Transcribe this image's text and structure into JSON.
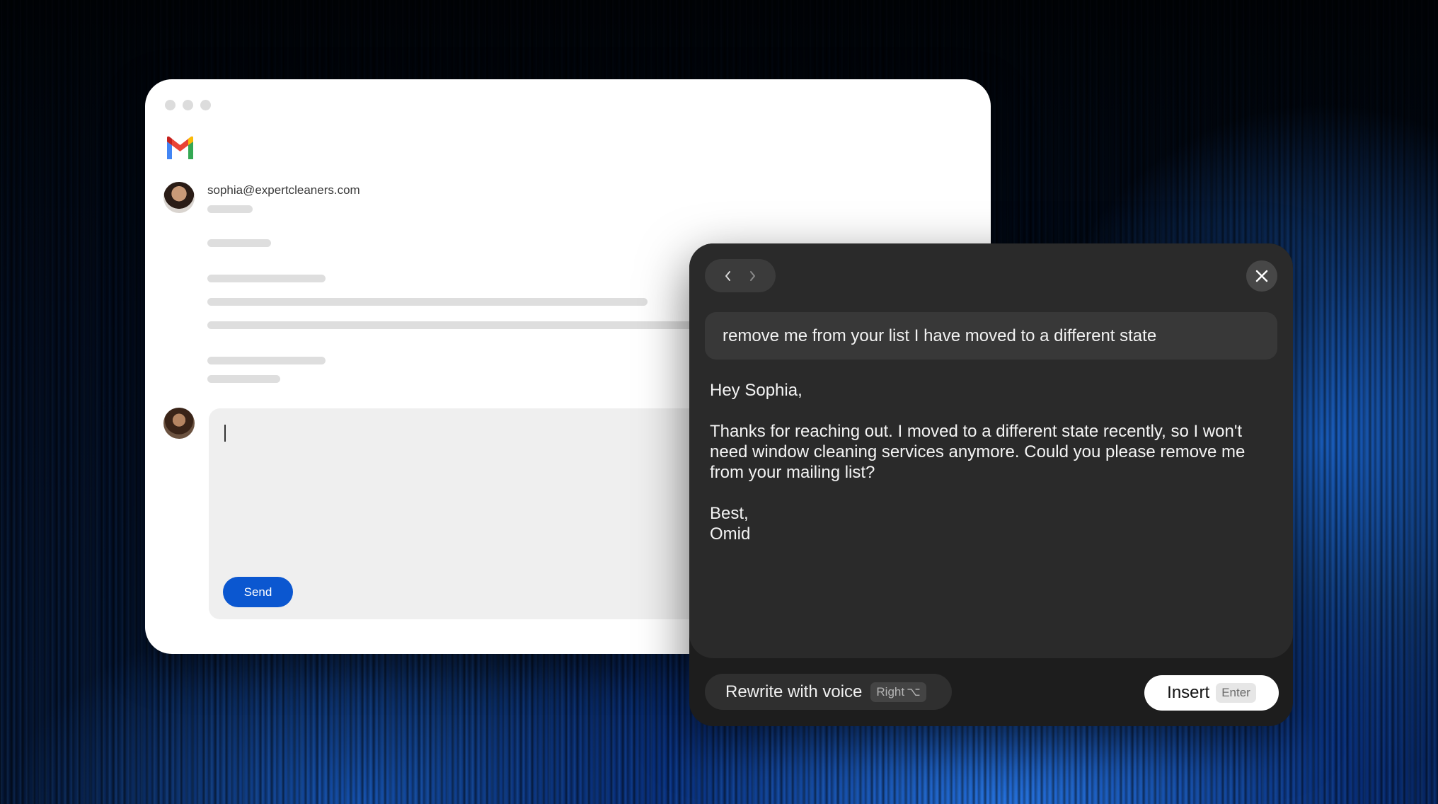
{
  "mail": {
    "sender_email": "sophia@expertcleaners.com",
    "send_label": "Send"
  },
  "assistant": {
    "prompt": "remove me from your list I have moved to a different state",
    "draft": {
      "greeting": "Hey Sophia,",
      "body": "Thanks for reaching out. I moved to a different state recently, so I won't need window cleaning services anymore. Could you please remove me from your mailing list?",
      "signoff": "Best,",
      "signature": "Omid"
    },
    "rewrite_label": "Rewrite with voice",
    "rewrite_shortcut": "Right",
    "rewrite_shortcut_symbol": "⌥",
    "insert_label": "Insert",
    "insert_shortcut": "Enter"
  },
  "colors": {
    "send_button": "#0b57d0",
    "panel_background": "#2a2a2a",
    "panel_footer": "#1d1d1d"
  },
  "icons": [
    "gmail-logo-icon",
    "chevron-left-icon",
    "chevron-right-icon",
    "close-icon"
  ]
}
